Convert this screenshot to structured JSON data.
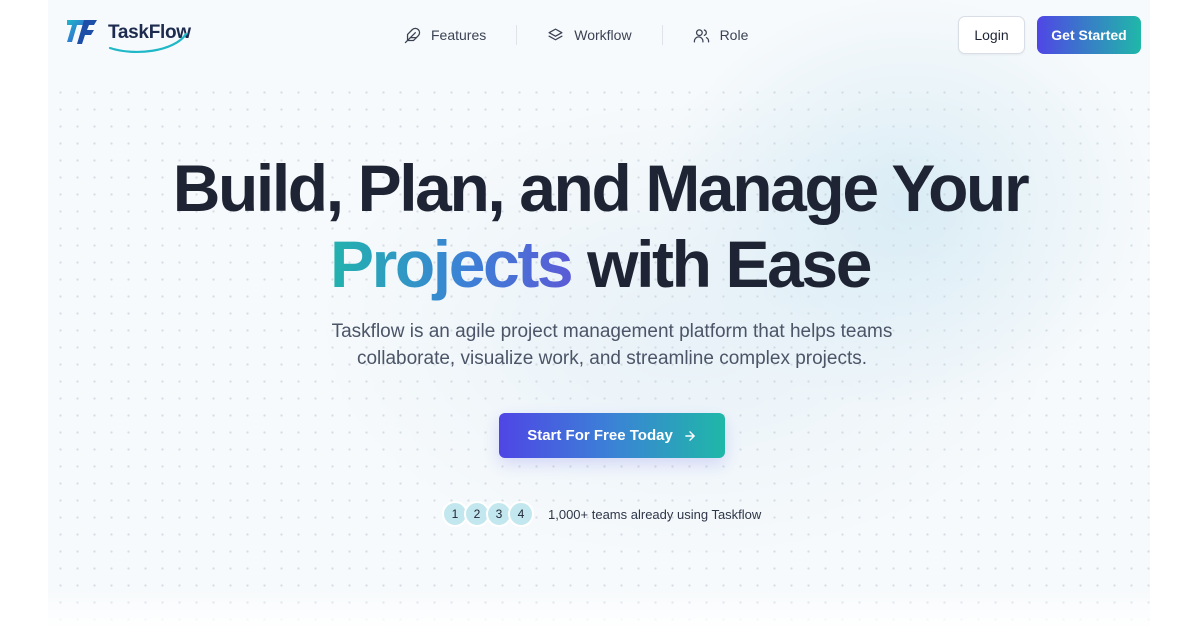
{
  "brand": {
    "name": "TaskFlow",
    "logo_icon": "taskflow-logo-mark"
  },
  "nav": {
    "links": [
      {
        "label": "Features",
        "icon": "feather-icon"
      },
      {
        "label": "Workflow",
        "icon": "layers-icon"
      },
      {
        "label": "Role",
        "icon": "users-icon"
      }
    ],
    "login_label": "Login",
    "get_started_label": "Get Started"
  },
  "hero": {
    "headline_line1": "Build, Plan, and Manage Your",
    "headline_accent": "Projects",
    "headline_rest": "with Ease",
    "subtitle_line1": "Taskflow is an agile project management platform that helps teams",
    "subtitle_line2": "collaborate, visualize work, and streamline complex projects.",
    "cta_label": "Start For Free Today",
    "cta_icon": "arrow-right-icon"
  },
  "social_proof": {
    "avatars": [
      "1",
      "2",
      "3",
      "4"
    ],
    "text": "1,000+ teams already using Taskflow"
  },
  "colors": {
    "brand_indigo": "#4f46e5",
    "brand_teal": "#1fb8a8",
    "text_dark": "#1e2433",
    "avatar_bg": "#c3e7ee"
  }
}
